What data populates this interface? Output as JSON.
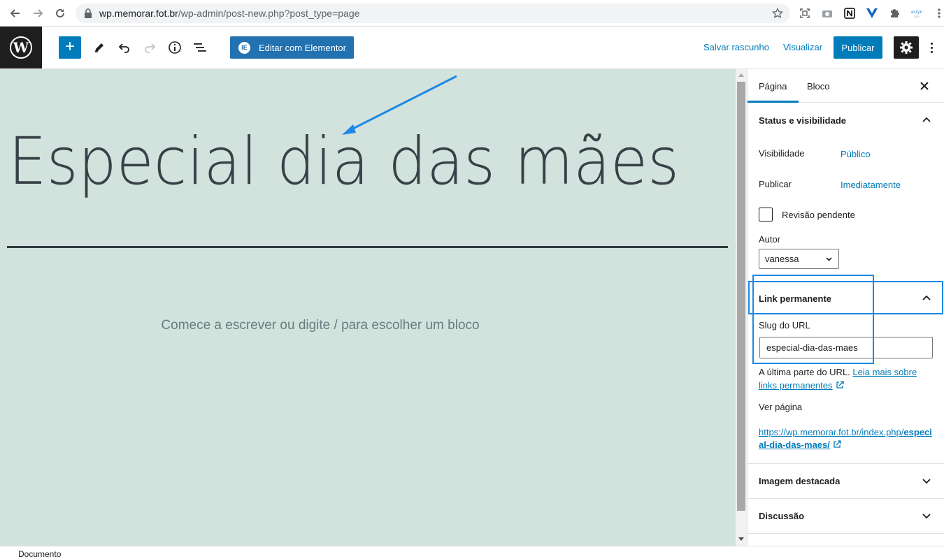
{
  "browser": {
    "url_host": "wp.memorar.fot.br",
    "url_path": "/wp-admin/post-new.php?post_type=page"
  },
  "toolbar": {
    "elementor_label": "Editar com Elementor",
    "save_draft_label": "Salvar rascunho",
    "preview_label": "Visualizar",
    "publish_label": "Publicar"
  },
  "editor": {
    "title": "Especial dia das mães",
    "placeholder": "Comece a escrever ou digite / para escolher um bloco"
  },
  "sidebar": {
    "tabs": [
      {
        "label": "Página",
        "active": true
      },
      {
        "label": "Bloco",
        "active": false
      }
    ],
    "status_panel": {
      "title": "Status e visibilidade",
      "visibility_label": "Visibilidade",
      "visibility_value": "Público",
      "publish_label": "Publicar",
      "publish_value": "Imediatamente",
      "pending_review_label": "Revisão pendente",
      "author_label": "Autor",
      "author_value": "vanessa"
    },
    "permalink_panel": {
      "title": "Link permanente",
      "slug_label": "Slug do URL",
      "slug_value": "especial-dia-das-maes",
      "help_text": "A última parte do URL.",
      "help_link": "Leia mais sobre links permanentes",
      "view_page_label": "Ver página",
      "page_url_plain": "https://wp.memorar.fot.br/index.php/",
      "page_url_bold": "especial-dia-das-maes/"
    },
    "featured_image_title": "Imagem destacada",
    "discussion_title": "Discussão"
  },
  "status_bar": {
    "text": "Documento"
  },
  "colors": {
    "accent": "#007cba",
    "canvas_bg": "#d2e3dd",
    "highlight": "#1e88e5"
  }
}
